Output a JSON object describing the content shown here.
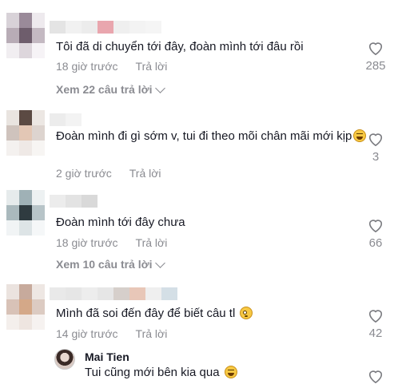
{
  "comments": [
    {
      "text": "Tôi đã di chuyển tới đây, đoàn mình tới đâu rồi",
      "time": "18 giờ trước",
      "reply_label": "Trả lời",
      "likes": "285",
      "view_replies": "Xem 22 câu trả lời"
    },
    {
      "text": "Đoàn mình đi gì sớm v, tui đi theo mõi chân mãi mới kịp",
      "time": "2 giờ trước",
      "reply_label": "Trả lời",
      "likes": "3"
    },
    {
      "text": "Đoàn mình tới đây chưa",
      "time": "18 giờ trước",
      "reply_label": "Trả lời",
      "likes": "66",
      "view_replies": "Xem 10 câu trả lời"
    },
    {
      "text": "Mình đã soi đến đây để biết câu tl",
      "time": "14 giờ trước",
      "reply_label": "Trả lời",
      "likes": "42",
      "reply": {
        "name": "Mai Tien",
        "text": "Tui cũng mới bên kia qua"
      }
    }
  ],
  "icons": {
    "like": "heart-outline-icon",
    "expand": "chevron-down-icon",
    "emoji_laugh": "grinning-squinting-emoji",
    "emoji_flushed": "flushed-face-emoji"
  },
  "colors": {
    "text": "#161823",
    "meta": "#8a8b91",
    "background": "#ffffff"
  }
}
